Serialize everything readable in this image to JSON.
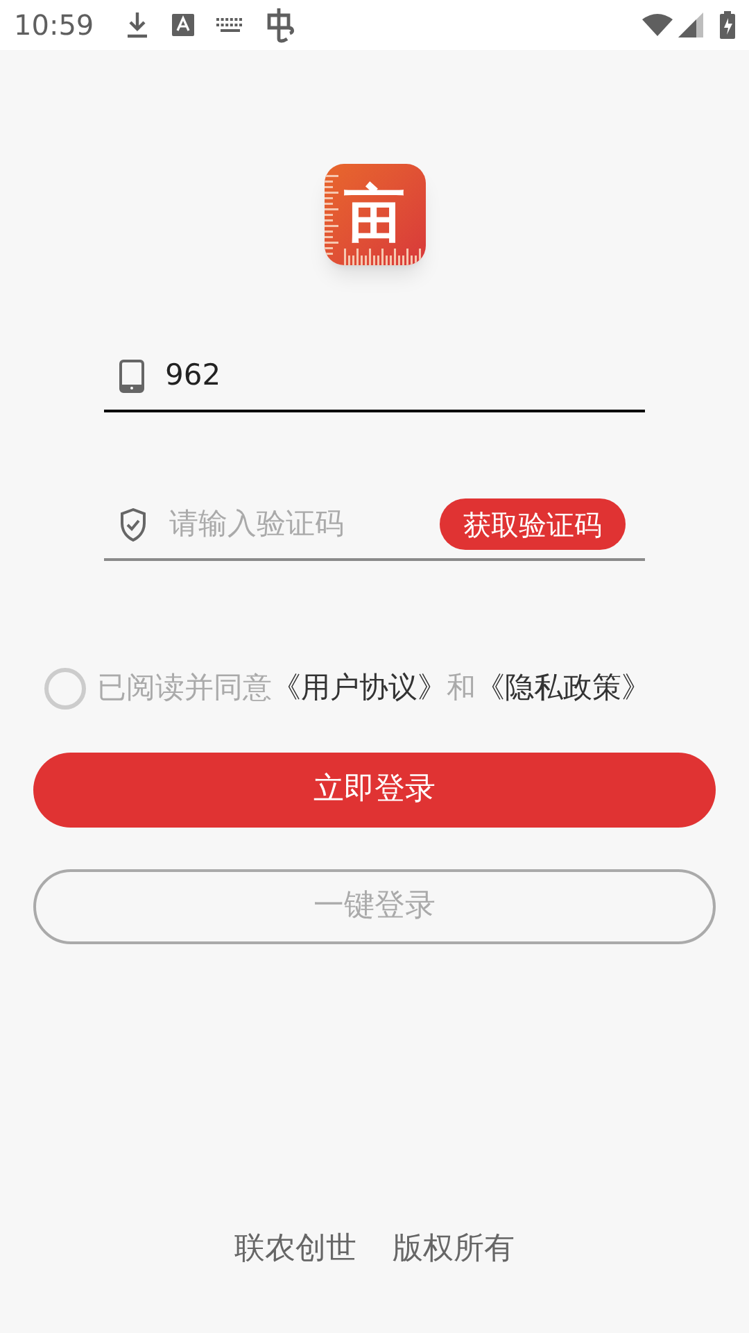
{
  "status_bar": {
    "time": "10:59"
  },
  "logo": {
    "text": "亩"
  },
  "phone_field": {
    "value": "962"
  },
  "code_field": {
    "placeholder": "请输入验证码",
    "button": "获取验证码"
  },
  "agreement": {
    "checked": false,
    "parts": [
      {
        "kind": "plain",
        "text": "已阅读并同意"
      },
      {
        "kind": "link",
        "text": "《用户协议》"
      },
      {
        "kind": "plain",
        "text": "和"
      },
      {
        "kind": "link",
        "text": "《隐私政策》"
      }
    ]
  },
  "buttons": [
    {
      "kind": "primary",
      "label": "立即登录"
    },
    {
      "kind": "outline",
      "label": "一键登录"
    }
  ],
  "footer": [
    "联农创世",
    "版权所有"
  ]
}
